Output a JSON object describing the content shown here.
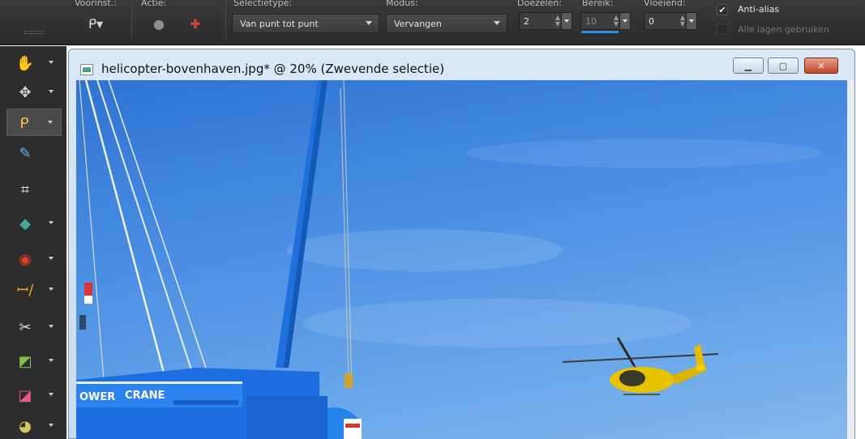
{
  "toolbar": {
    "labels": {
      "presets": "Voorinst.:",
      "action": "Actie:",
      "selection_type": "Selectietype:",
      "mode": "Modus:",
      "smoothing": "Doezelen:",
      "range": "Bereik:",
      "feather": "Vloeiend:"
    },
    "selection_type_value": "Van punt tot punt",
    "mode_value": "Vervangen",
    "smoothing_value": "2",
    "range_value": "10",
    "feather_value": "0",
    "anti_alias_label": "Anti-alias",
    "anti_alias_checked": true,
    "use_all_layers_label": "Alle lagen gebruiken",
    "use_all_layers_checked": false,
    "accent_color": "#2e8fe0"
  },
  "tools": [
    {
      "name": "pan-tool",
      "icon": "hand-icon",
      "active": false
    },
    {
      "name": "move-tool",
      "icon": "move-arrows-icon",
      "active": false
    },
    {
      "name": "lasso-tool",
      "icon": "lasso-icon",
      "active": true
    },
    {
      "name": "dropper-tool",
      "icon": "dropper-icon",
      "active": false
    },
    {
      "name": "crop-tool",
      "icon": "crop-icon",
      "active": false
    },
    {
      "name": "straighten-tool",
      "icon": "straighten-icon",
      "active": false
    },
    {
      "name": "red-eye-tool",
      "icon": "eye-icon",
      "active": false
    },
    {
      "name": "text-tool",
      "icon": "text-icon",
      "active": false
    },
    {
      "name": "brush-tool",
      "icon": "brush-icon",
      "active": false
    },
    {
      "name": "retouch-tool",
      "icon": "retouch-icon",
      "active": false
    },
    {
      "name": "eraser-tool",
      "icon": "eraser-icon",
      "active": false
    },
    {
      "name": "fill-tool",
      "icon": "fill-icon",
      "active": false
    }
  ],
  "document": {
    "title": "helicopter-bovenhaven.jpg* @  20% (Zwevende selectie)",
    "crane_text_left": "OWER",
    "crane_text_right": "CRANE",
    "minimize_label": "▁",
    "maximize_label": "▢",
    "close_label": "✕"
  }
}
